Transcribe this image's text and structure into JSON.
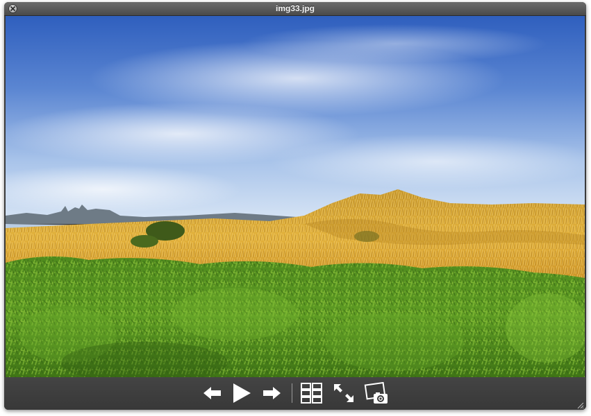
{
  "window": {
    "title": "img33.jpg"
  },
  "toolbar": {
    "buttons": [
      {
        "name": "previous",
        "icon": "arrow-left-icon"
      },
      {
        "name": "play",
        "icon": "play-icon"
      },
      {
        "name": "next",
        "icon": "arrow-right-icon"
      },
      {
        "name": "index-sheet",
        "icon": "grid-icon"
      },
      {
        "name": "full-screen",
        "icon": "fullscreen-arrows-icon"
      },
      {
        "name": "add-to-iphoto",
        "icon": "camera-photo-icon"
      }
    ]
  },
  "colors": {
    "window_chrome": "#3a3a3a",
    "titlebar_text": "#f2f2f2",
    "icon": "#ffffff"
  }
}
